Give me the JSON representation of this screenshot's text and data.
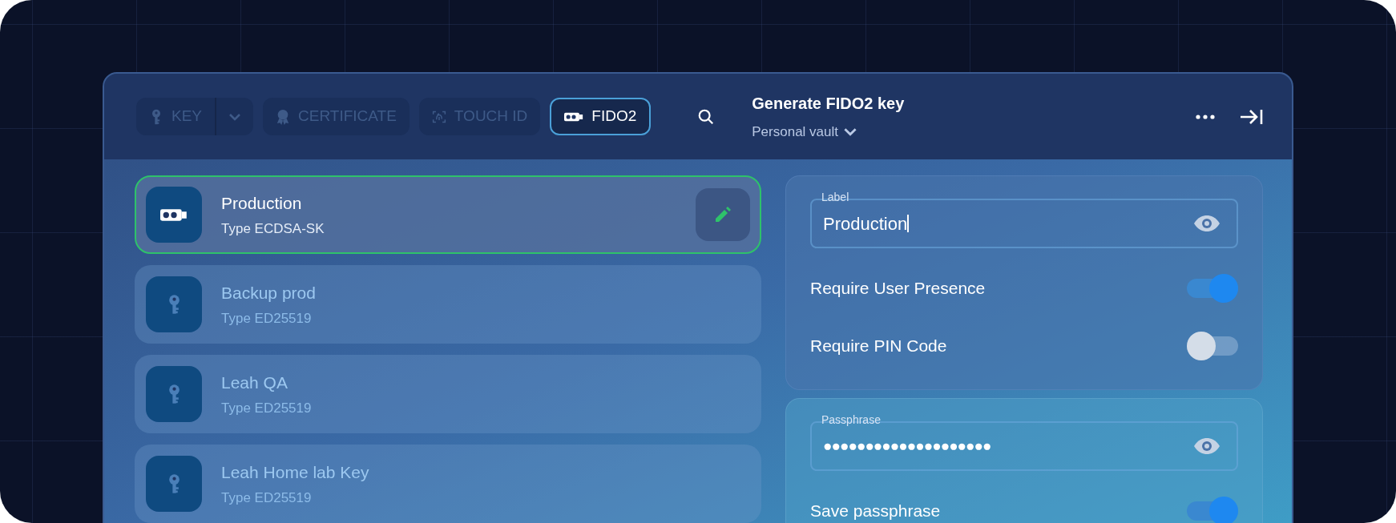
{
  "tabs": [
    {
      "label": "KEY",
      "kind": "key",
      "dropdown": true,
      "selected": false
    },
    {
      "label": "CERTIFICATE",
      "kind": "certificate",
      "dropdown": false,
      "selected": false
    },
    {
      "label": "TOUCH ID",
      "kind": "fingerprint",
      "dropdown": false,
      "selected": false
    },
    {
      "label": "FIDO2",
      "kind": "fido",
      "dropdown": false,
      "selected": true
    }
  ],
  "header": {
    "title": "Generate FIDO2 key",
    "vault": "Personal vault"
  },
  "keys": [
    {
      "name": "Production",
      "type": "Type ECDSA-SK",
      "kind": "fido",
      "selected": true
    },
    {
      "name": "Backup prod",
      "type": "Type ED25519",
      "kind": "key",
      "selected": false
    },
    {
      "name": "Leah QA",
      "type": "Type ED25519",
      "kind": "key",
      "selected": false
    },
    {
      "name": "Leah Home lab Key",
      "type": "Type ED25519",
      "kind": "key",
      "selected": false
    }
  ],
  "label_field": {
    "label": "Label",
    "value": "Production"
  },
  "options": [
    {
      "label": "Require User Presence",
      "on": true
    },
    {
      "label": "Require PIN Code",
      "on": false
    }
  ],
  "passphrase_field": {
    "label": "Passphrase",
    "value": "●●●●●●●●●●●●●●●●●●●●"
  },
  "passphrase_options": [
    {
      "label": "Save passphrase",
      "on": true
    }
  ]
}
